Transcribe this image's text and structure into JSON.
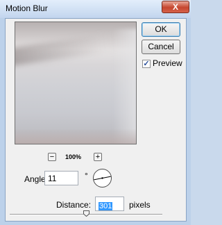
{
  "window": {
    "title": "Motion Blur",
    "close_label": "X"
  },
  "buttons": {
    "ok": "OK",
    "cancel": "Cancel"
  },
  "preview": {
    "checkbox_label": "Preview",
    "checked": true
  },
  "zoom": {
    "minus": "−",
    "plus": "+",
    "level": "100%"
  },
  "angle": {
    "label": "Angle:",
    "value": "11",
    "unit": "°",
    "degrees": 11
  },
  "distance": {
    "label": "Distance:",
    "value": "301",
    "unit": "pixels",
    "slider_fraction": 0.5
  },
  "colors": {
    "selection": "#3399ff",
    "close_button": "#c6462f"
  }
}
